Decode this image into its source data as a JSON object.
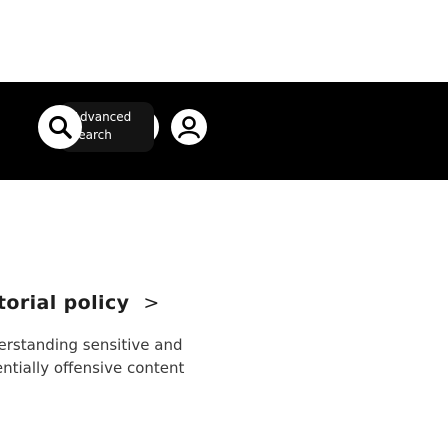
{
  "header": {
    "background": "#000000",
    "search_button": {
      "label_line1": "Advanced",
      "label_line2": "search",
      "icon": "search-icon"
    },
    "info_button": {
      "icon": "info-icon"
    },
    "account_button": {
      "icon": "user-icon"
    }
  },
  "policy_link": {
    "title": "itorial policy",
    "chevron": ">",
    "description_line1": "derstanding sensitive and",
    "description_line2": "tentially offensive content"
  }
}
